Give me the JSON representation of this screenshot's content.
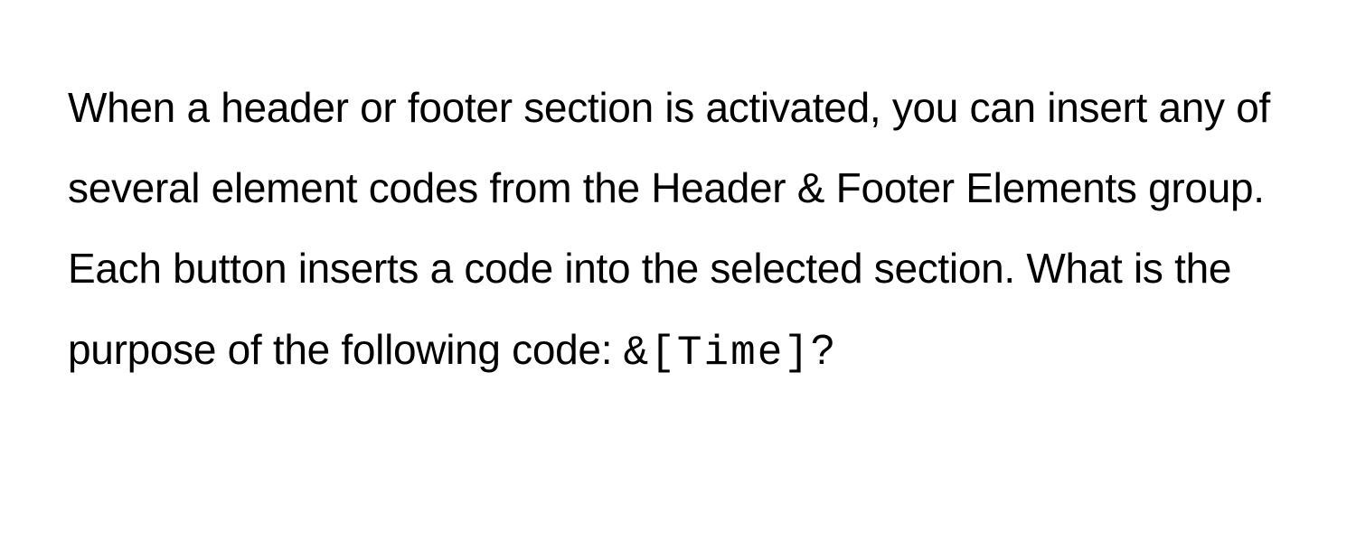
{
  "question": {
    "text_before_code": "When a header or footer section is activated, you can insert any of several element codes from the Header & Footer Elements group. Each button inserts a code into the selected section. What is the purpose of the following code: ",
    "code": "&[Time]",
    "text_after_code": "?"
  }
}
